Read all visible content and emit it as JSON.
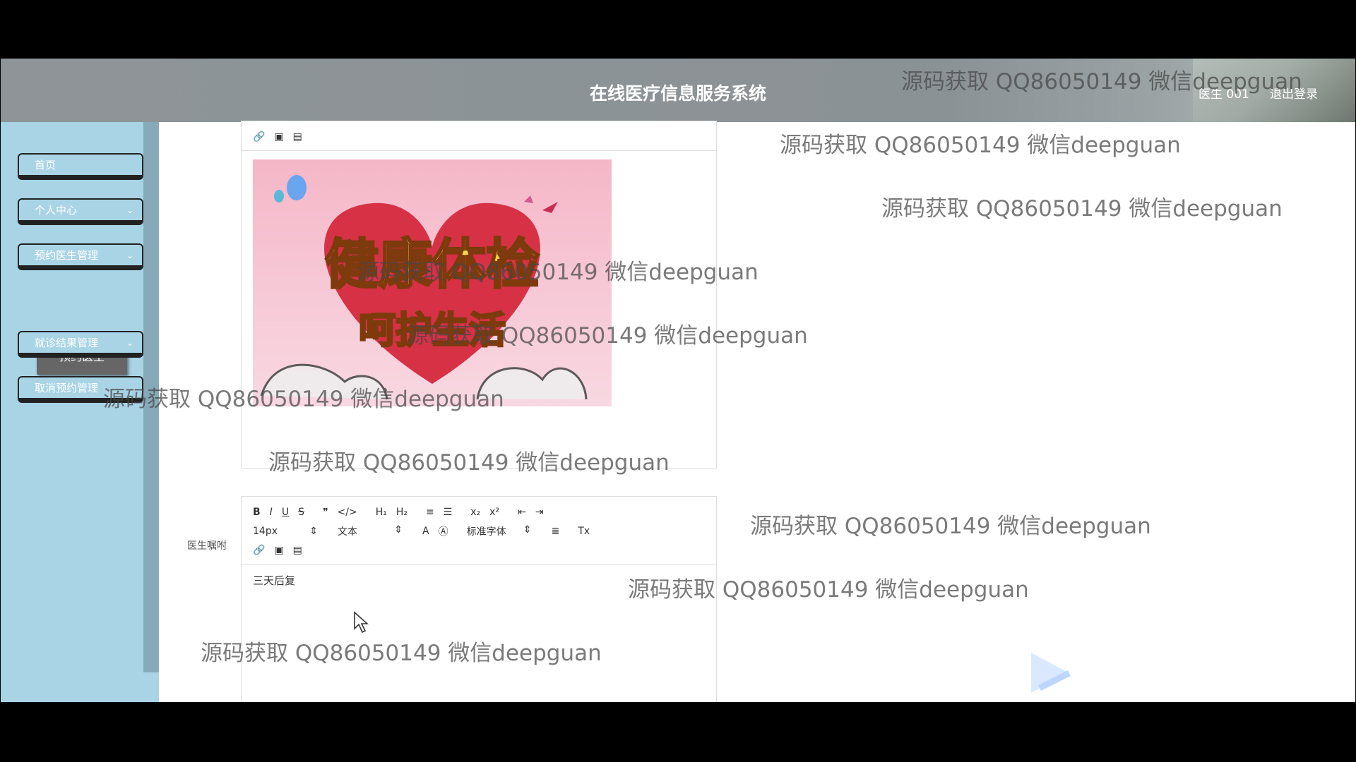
{
  "header": {
    "title": "在线医疗信息服务系统",
    "user": "医生 001",
    "logout": "退出登录"
  },
  "sidebar": {
    "items": [
      {
        "label": "首页",
        "has_chevron": false
      },
      {
        "label": "个人中心",
        "has_chevron": true
      },
      {
        "label": "预约医生管理",
        "has_chevron": true
      },
      {
        "label": "就诊结果管理",
        "has_chevron": true
      },
      {
        "label": "取消预约管理",
        "has_chevron": false
      }
    ],
    "active_sub_item": "预约医生"
  },
  "editor1": {
    "image_alt": "健康体检 呵护生活",
    "image_lines": [
      "健康体检",
      "呵护生活"
    ]
  },
  "editor2": {
    "label": "医生嘱咐",
    "font_size": "14px",
    "block_type": "文本",
    "font_family": "标准字体",
    "content": "三天后复"
  },
  "watermark": "源码获取 QQ86050149 微信deepguan",
  "icons": [
    "link-icon",
    "image-icon",
    "video-icon",
    "bold-icon",
    "italic-icon",
    "underline-icon",
    "strike-icon",
    "quote-icon",
    "code-icon",
    "h1-icon",
    "h2-icon",
    "ordered-list-icon",
    "bullet-list-icon",
    "subscript-icon",
    "superscript-icon",
    "outdent-icon",
    "indent-icon",
    "font-color-icon",
    "background-color-icon",
    "align-icon",
    "clear-format-icon",
    "chevron-down-icon",
    "cursor-icon"
  ]
}
